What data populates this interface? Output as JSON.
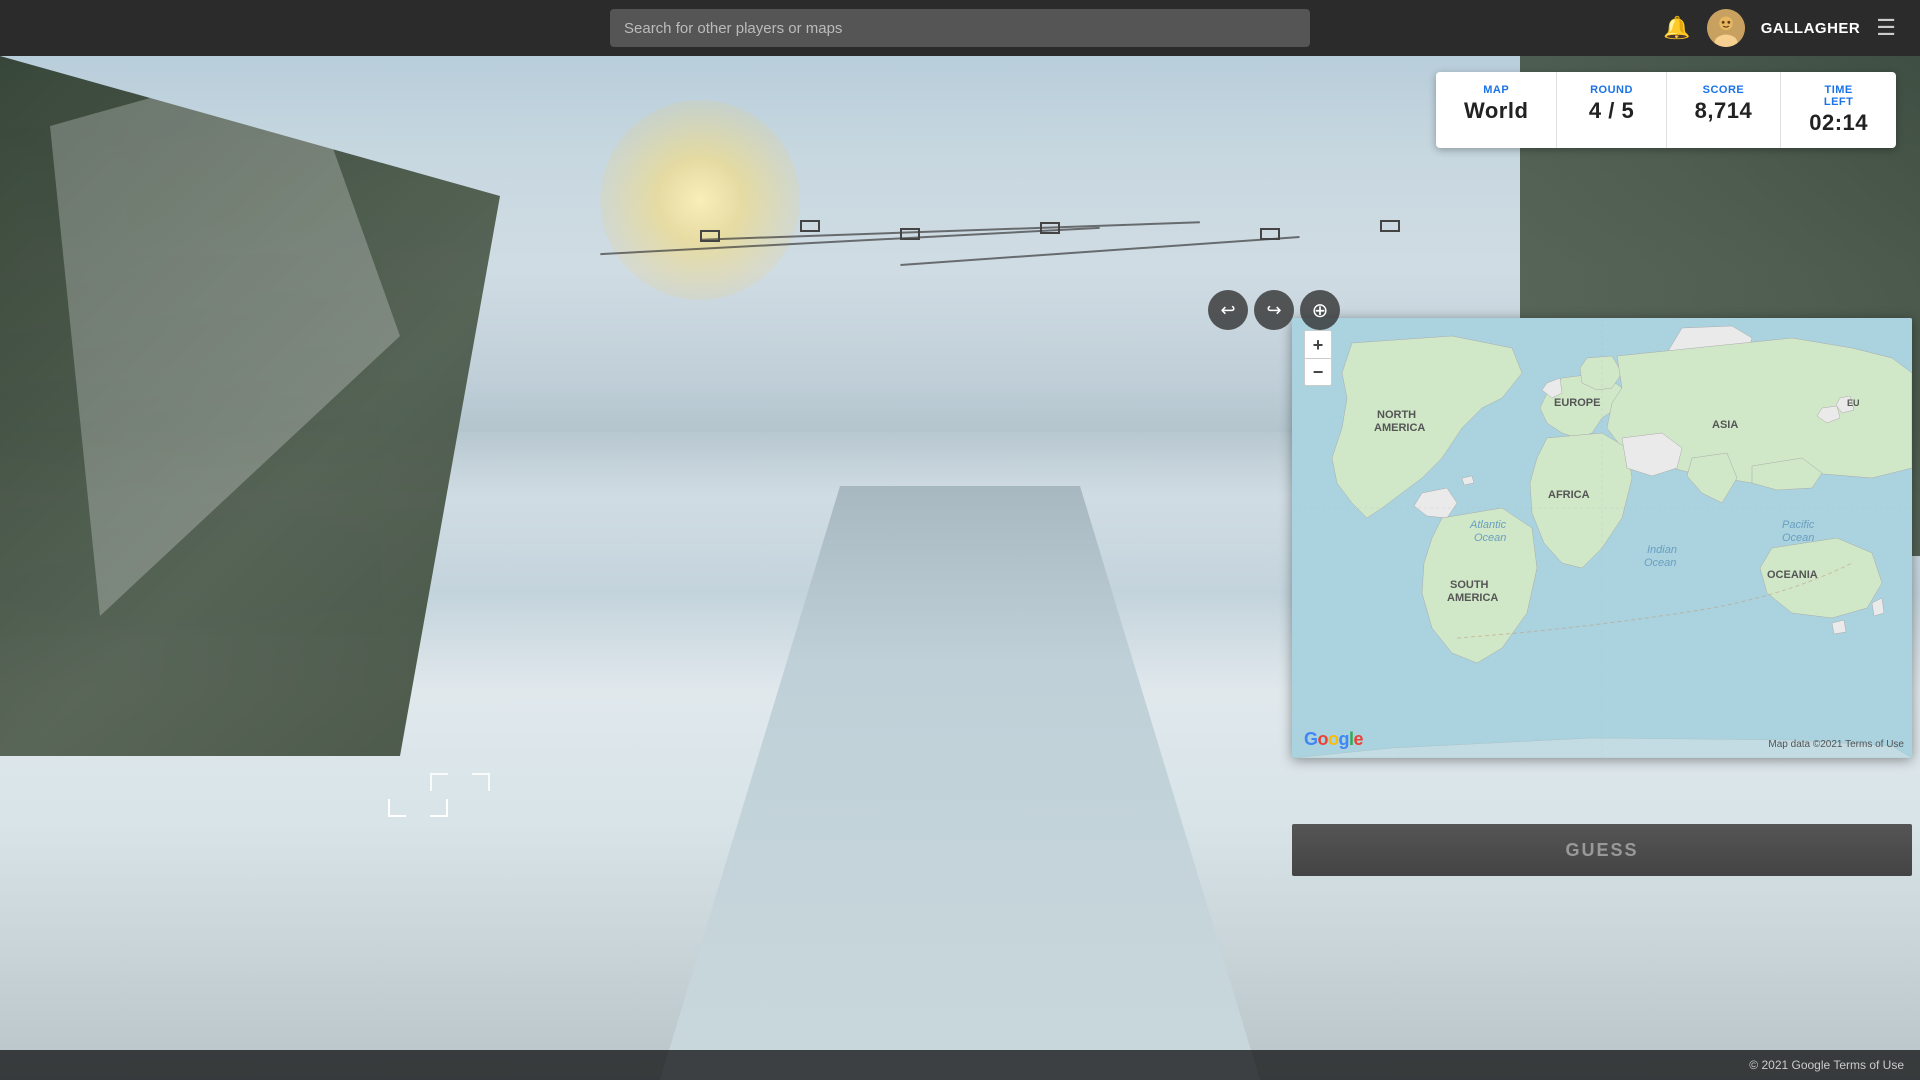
{
  "header": {
    "search_placeholder": "Search for other players or maps",
    "username": "GALLAGHER"
  },
  "hud": {
    "map_label": "MAP",
    "map_value": "World",
    "round_label": "ROUND",
    "round_value": "4 / 5",
    "score_label": "SCORE",
    "score_value": "8,714",
    "time_label": "TIME LEFT",
    "time_value": "02:14"
  },
  "map": {
    "zoom_in": "+",
    "zoom_out": "−",
    "copyright": "Map data ©2021   Terms of Use",
    "google_logo": "Google"
  },
  "guess": {
    "button_label": "GUESS"
  },
  "footer": {
    "text": "© 2021 Google   Terms of Use"
  },
  "controls": {
    "back": "↩",
    "forward": "↪",
    "zoom_toggle": "⊕"
  }
}
